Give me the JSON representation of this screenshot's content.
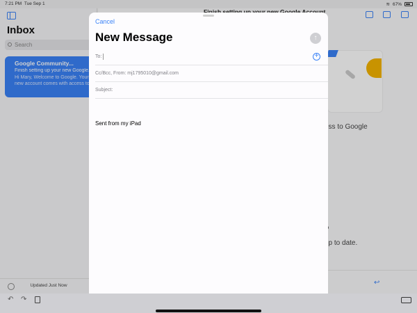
{
  "status": {
    "time": "7:21 PM",
    "date": "Tue Sep 1",
    "battery": "67%"
  },
  "sidebar": {
    "title": "Inbox",
    "search_placeholder": "Search",
    "mail": {
      "from": "Google Community...",
      "subject": "Finish setting up your new Google...",
      "preview": "Hi Mary, Welcome to Google. Your new account comes with access to Google"
    },
    "updated": "Updated Just Now"
  },
  "content": {
    "title": "Finish setting up your new Google Account",
    "fragment1": "ess to Google",
    "fragment2": "o",
    "fragment3": "up to date."
  },
  "compose": {
    "cancel": "Cancel",
    "title": "New Message",
    "to_label": "To:",
    "cc_label": "Cc/Bcc, From:",
    "from_address": "mj1795010@gmail.com",
    "subject_label": "Subject:",
    "signature": "Sent from my iPad"
  }
}
